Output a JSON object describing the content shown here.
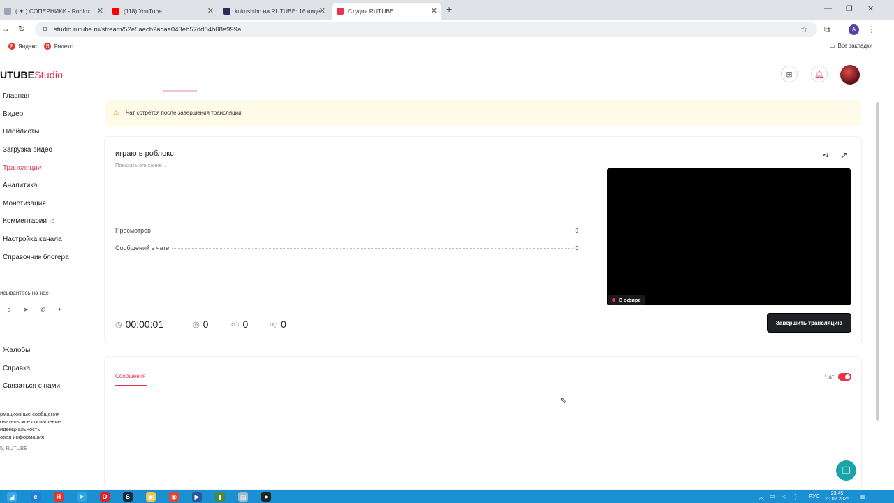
{
  "browser": {
    "tabs": [
      {
        "label": "( ✦ ) СОПЕРНИКИ - Roblox",
        "color": "#9aa5b5"
      },
      {
        "label": "(118) YouTube",
        "color": "#ff0000"
      },
      {
        "label": "kukushibo на RUTUBE: 16 виде",
        "color": "#2b2b5a"
      },
      {
        "label": "Студия RUTUBE",
        "color": "#e8334a"
      }
    ],
    "url": "studio.rutube.ru/stream/52e5aecb2acae043eb57dd84b08e999a",
    "profile_initial": "A",
    "bookmarks": [
      "Яндекс",
      "Яндекс"
    ],
    "all_bookmarks": "Все закладки"
  },
  "studio": {
    "logo_main": "UTUBE",
    "logo_accent": "Studio"
  },
  "sidebar": {
    "items": [
      {
        "label": "Главная"
      },
      {
        "label": "Видео"
      },
      {
        "label": "Плейлисты"
      },
      {
        "label": "Загрузка видео"
      },
      {
        "label": "Трансляции",
        "active": true
      },
      {
        "label": "Аналитика"
      },
      {
        "label": "Монетизация"
      },
      {
        "label": "Комментарии",
        "badge": "+3"
      },
      {
        "label": "Настройка канала"
      },
      {
        "label": "Справочник блогера"
      }
    ],
    "follow_text": "исывайтесь на нас",
    "links": [
      "Жалобы",
      "Справка",
      "Связаться с нами"
    ],
    "footer": [
      "рмационные сообщения",
      "овательское соглашение",
      "иденциальность",
      "овая информация",
      "5, RUTUBE"
    ]
  },
  "warning": "Чат сотрётся после завершения трансляции",
  "stream": {
    "title": "играю в роблокс",
    "show_description": "Показать описание",
    "stats": [
      {
        "label": "Просмотров",
        "value": "0"
      },
      {
        "label": "Сообщений в чате",
        "value": "0"
      }
    ],
    "live_badge": "В эфире",
    "timer": "00:00:01",
    "viewers": "0",
    "likes": "0",
    "dislikes": "0",
    "end_button": "Завершить трансляцию"
  },
  "chat": {
    "tab_label": "Сообщения",
    "toggle_label": "Чат",
    "toggle_on": true
  },
  "taskbar": {
    "lang": "РУС",
    "time": "23:45",
    "date": "20.02.2025"
  }
}
